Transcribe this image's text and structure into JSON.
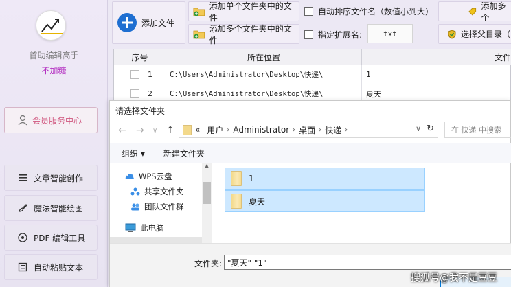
{
  "sidebar": {
    "app_name": "首助编辑高手",
    "app_sub": "不加糖",
    "member_label": "会员服务中心",
    "nav": [
      {
        "label": "文章智能创作",
        "icon": "list-icon"
      },
      {
        "label": "魔法智能绘图",
        "icon": "brush-icon"
      },
      {
        "label": "PDF 编辑工具",
        "icon": "pdf-icon"
      },
      {
        "label": "自动粘贴文本",
        "icon": "paste-icon"
      }
    ]
  },
  "toolbar": {
    "add_file": "添加文件",
    "add_single_folder": "添加单个文件夹中的文件",
    "add_multi_folder": "添加多个文件夹中的文件",
    "auto_sort": "自动排序文件名（数值小到大）",
    "specify_ext": "指定扩展名:",
    "ext_value": "txt",
    "add_more": "添加多个",
    "select_parent": "选择父目录（"
  },
  "table": {
    "headers": [
      "序号",
      "所在位置",
      "文件"
    ],
    "rows": [
      {
        "index": "1",
        "path": "C:\\Users\\Administrator\\Desktop\\快递\\",
        "file": "1"
      },
      {
        "index": "2",
        "path": "C:\\Users\\Administrator\\Desktop\\快递\\",
        "file": "夏天"
      }
    ]
  },
  "dialog": {
    "title": "请选择文件夹",
    "breadcrumb": [
      "用户",
      "Administrator",
      "桌面",
      "快递"
    ],
    "breadcrumb_prefix": "«",
    "search_placeholder": "在 快递 中搜索",
    "organize": "组织 ▾",
    "new_folder": "新建文件夹",
    "tree": [
      {
        "label": "WPS云盘",
        "icon": "cloud-icon"
      },
      {
        "label": "共享文件夹",
        "icon": "share-icon"
      },
      {
        "label": "团队文件群",
        "icon": "team-icon"
      },
      {
        "label": "此电脑",
        "icon": "computer-icon"
      }
    ],
    "files": [
      "1",
      "夏天"
    ],
    "filename_label": "文件夹:",
    "filename_value": "\"夏天\" \"1\""
  },
  "watermark": "搜狐号@我不是豆豆",
  "colors": {
    "accent": "#b32fc1",
    "selection": "#cde8ff",
    "member": "#d0577f"
  }
}
